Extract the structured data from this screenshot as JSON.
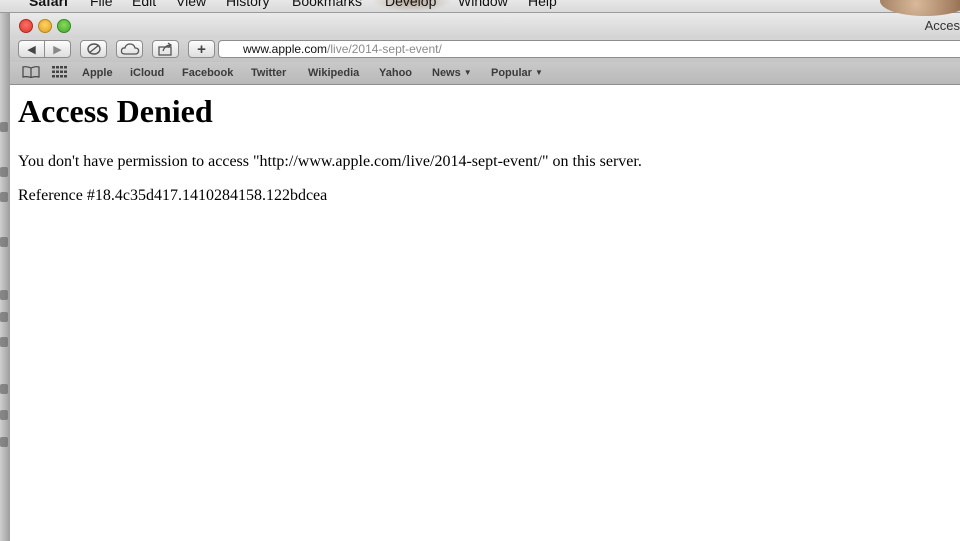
{
  "menubar": {
    "items": [
      "Safari",
      "File",
      "Edit",
      "View",
      "History",
      "Bookmarks",
      "Develop",
      "Window",
      "Help"
    ]
  },
  "window": {
    "title": "Acces"
  },
  "toolbar": {
    "url_host": "www.apple.com",
    "url_path": "/live/2014-sept-event/",
    "add_label": "+"
  },
  "bookmarks": {
    "items": [
      "Apple",
      "iCloud",
      "Facebook",
      "Twitter",
      "Wikipedia",
      "Yahoo"
    ],
    "menus": [
      "News",
      "Popular"
    ]
  },
  "page": {
    "heading": "Access Denied",
    "message": "You don't have permission to access \"http://www.apple.com/live/2014-sept-event/\" on this server.",
    "reference": "Reference #18.4c35d417.1410284158.122bdcea"
  },
  "colors": {
    "close": "#ff5f57",
    "minimize": "#ffbd2e",
    "zoom": "#28c940"
  }
}
